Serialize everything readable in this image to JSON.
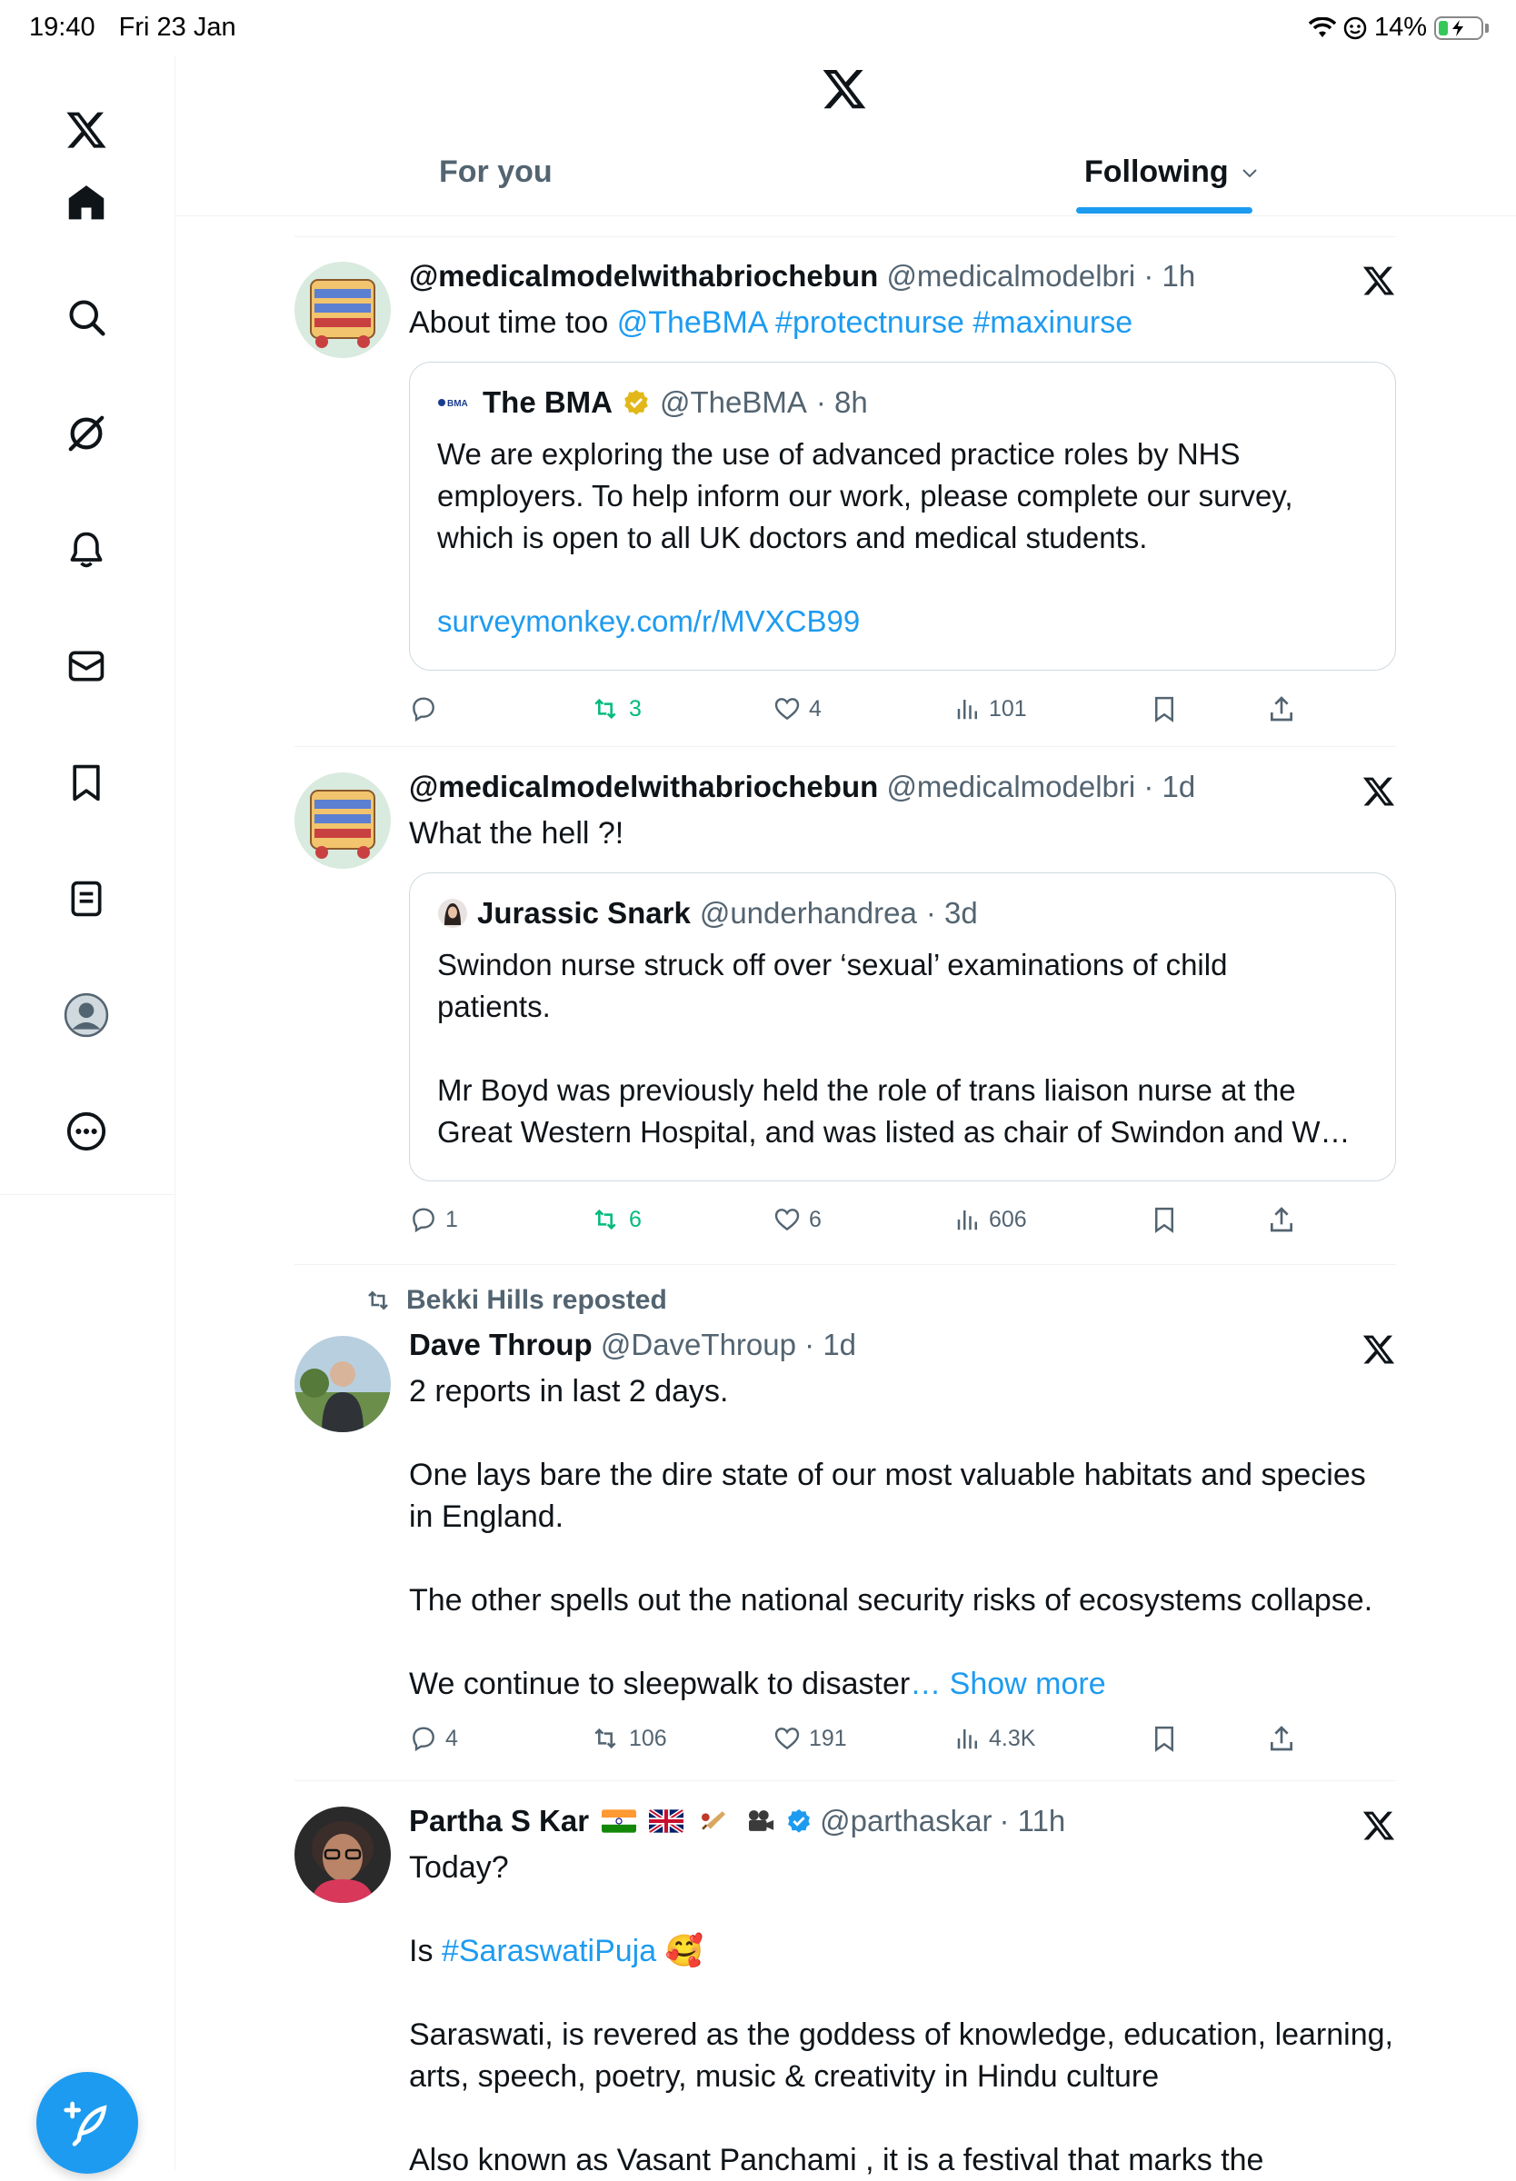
{
  "status_bar": {
    "time": "19:40",
    "date": "Fri 23 Jan",
    "battery": "14%"
  },
  "header": {
    "tab_for_you": "For you",
    "tab_following": "Following"
  },
  "sidebar": {
    "items": [
      {
        "name": "x-logo"
      },
      {
        "name": "home"
      },
      {
        "name": "search"
      },
      {
        "name": "grok"
      },
      {
        "name": "notifications"
      },
      {
        "name": "messages"
      },
      {
        "name": "bookmarks"
      },
      {
        "name": "lists"
      },
      {
        "name": "profile"
      },
      {
        "name": "more"
      }
    ]
  },
  "tweets": [
    {
      "name": "@medicalmodelwithabriochebun",
      "handle": "@medicalmodelbri",
      "time": "· 1h",
      "text_plain": "About time too ",
      "text_links": "@TheBMA #protectnurse #maxinurse",
      "quote": {
        "badge": "BMA",
        "name": "The BMA",
        "handle": "@TheBMA",
        "time": "· 8h",
        "text": "We are exploring the use of advanced practice roles by NHS\nemployers. To help inform our work, please complete our survey,\nwhich is open to all UK doctors and medical students.",
        "link": "surveymonkey.com/r/MVXCB99"
      },
      "replies": "",
      "reposts": "3",
      "likes": "4",
      "views": "101"
    },
    {
      "name": "@medicalmodelwithabriochebun",
      "handle": "@medicalmodelbri",
      "time": "· 1d",
      "text": "What the hell ?!",
      "quote": {
        "name": "Jurassic Snark",
        "handle": "@underhandrea",
        "time": "· 3d",
        "text": "Swindon nurse struck off over ‘sexual’ examinations of child\npatients.\n\nMr Boyd was previously held the role of trans liaison nurse at the\nGreat Western Hospital, and was listed as chair of Swindon and W…"
      },
      "replies": "1",
      "reposts": "6",
      "likes": "6",
      "views": "606"
    },
    {
      "repost_by": "Bekki Hills reposted",
      "name": "Dave Throup",
      "handle": "@DaveThroup",
      "time": "· 1d",
      "text": "2 reports in last 2 days.\n\nOne lays bare the dire state of our most valuable habitats and species\nin England.\n\nThe other spells out the national security risks of ecosystems collapse.\n\nWe continue to sleepwalk to disaster",
      "show_more": "… Show more",
      "replies": "4",
      "reposts": "106",
      "likes": "191",
      "views": "4.3K"
    },
    {
      "name": "Partha S Kar",
      "handle": "@parthaskar",
      "time": "· 11h",
      "text_1": "Today?",
      "text_2_prefix": "Is ",
      "text_2_link": "#SaraswatiPuja",
      "text_2_emoji": "🥰",
      "text_3": "Saraswati, is revered as the goddess of knowledge, education, learning,\narts, speech, poetry, music & creativity in Hindu culture",
      "text_4": "Also known as Vasant Panchami , it is a festival that marks the"
    }
  ],
  "colors": {
    "accent": "#1d9bf0",
    "repost_green": "#00ba7c",
    "muted": "#536471",
    "gold": "#e2b719"
  }
}
